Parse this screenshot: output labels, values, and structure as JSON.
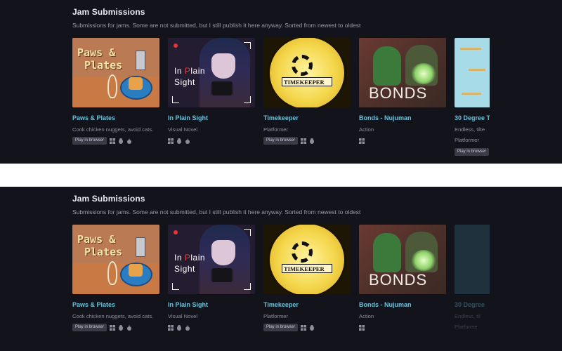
{
  "sections": [
    {
      "title": "Jam Submissions",
      "description": "Submissions for jams. Some are not submitted, but I still publish it here anyway. Sorted from newest to oldest"
    },
    {
      "title": "Jam Submissions",
      "description": "Submissions for jams. Some are not submitted, but I still publish it here anyway. Sorted from newest to oldest"
    }
  ],
  "games": [
    {
      "title": "Paws & Plates",
      "description": "Cook chicken nuggets, avoid cats.",
      "badge": "Play in browser",
      "platforms": [
        "windows-icon",
        "linux-icon",
        "apple-icon"
      ],
      "thumb_text_1": "Paws &",
      "thumb_text_2": "Plates"
    },
    {
      "title": "In Plain Sight",
      "description": "Visual Novel",
      "badge": "",
      "platforms": [
        "windows-icon",
        "linux-icon",
        "apple-icon"
      ],
      "thumb_text_1a": "In ",
      "thumb_text_1b": "P",
      "thumb_text_1c": "lain",
      "thumb_text_2": "Sight"
    },
    {
      "title": "Timekeeper",
      "description": "Platformer",
      "badge": "Play in browser",
      "platforms": [
        "windows-icon",
        "linux-icon"
      ],
      "thumb_text": "TIMEKEEPER"
    },
    {
      "title": "Bonds - Nujuman",
      "description": "Action",
      "badge": "",
      "platforms": [
        "windows-icon"
      ],
      "thumb_text": "BONDS"
    },
    {
      "title": "30 Degree T",
      "description": "Endless, tilte",
      "genre": "Platformer",
      "badge": "Play in browser",
      "platforms": []
    }
  ],
  "games_bottom_last": {
    "title": "30 Degree",
    "description": "Endless, til",
    "genre": "Platforme"
  },
  "colors": {
    "background": "#13141b",
    "title_link": "#6ec0d8",
    "badge_bg": "#3a3b47"
  }
}
